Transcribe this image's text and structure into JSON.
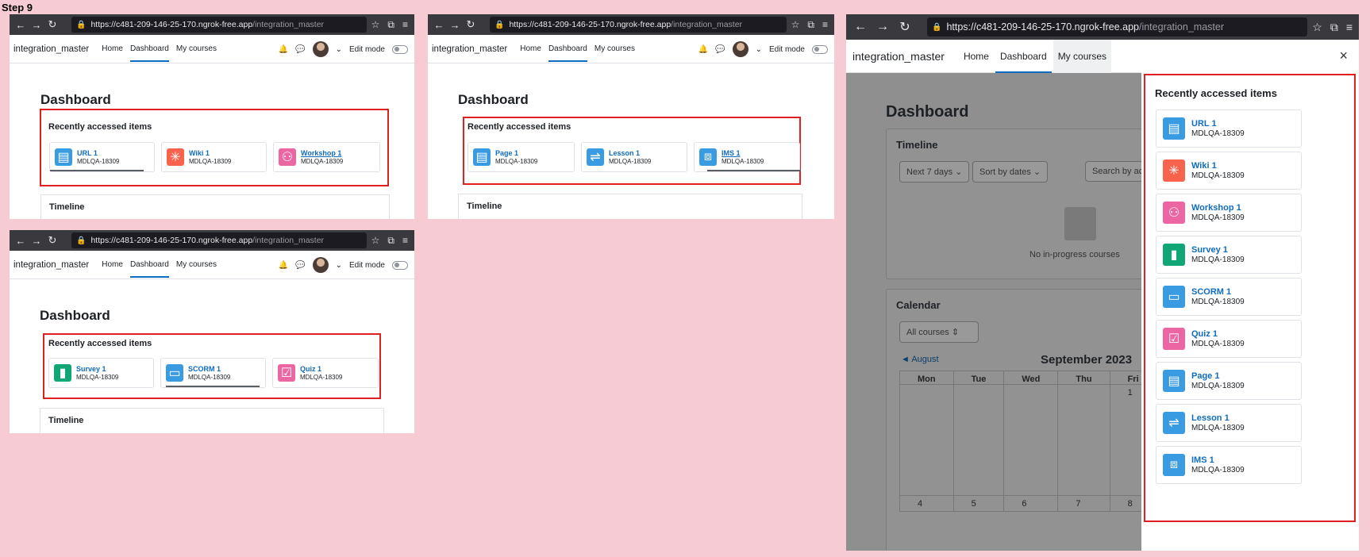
{
  "step_label": "Step 9",
  "browser": {
    "url_main": "https://c481-209-146-25-170.ngrok-free.app",
    "url_tail": "/integration_master"
  },
  "nav": {
    "brand": "integration_master",
    "home": "Home",
    "dashboard": "Dashboard",
    "my_courses": "My courses",
    "edit_mode": "Edit mode"
  },
  "page_title": "Dashboard",
  "recent_title": "Recently accessed items",
  "timeline_title": "Timeline",
  "panels": [
    {
      "items": [
        {
          "name": "URL 1",
          "course": "MDLQA-18309",
          "icon": "url-icon",
          "color": "#399be2"
        },
        {
          "name": "Wiki 1",
          "course": "MDLQA-18309",
          "icon": "wiki-icon",
          "color": "#f7634d"
        },
        {
          "name": "Workshop 1",
          "course": "MDLQA-18309",
          "icon": "workshop-icon",
          "color": "#eb66a2"
        }
      ]
    },
    {
      "items": [
        {
          "name": "Page 1",
          "course": "MDLQA-18309",
          "icon": "page-icon",
          "color": "#399be2"
        },
        {
          "name": "Lesson 1",
          "course": "MDLQA-18309",
          "icon": "lesson-icon",
          "color": "#399be2"
        },
        {
          "name": "IMS 1",
          "course": "MDLQA-18309",
          "icon": "ims-icon",
          "color": "#399be2"
        }
      ]
    },
    {
      "items": [
        {
          "name": "Survey 1",
          "course": "MDLQA-18309",
          "icon": "survey-icon",
          "color": "#11a676"
        },
        {
          "name": "SCORM 1",
          "course": "MDLQA-18309",
          "icon": "scorm-icon",
          "color": "#399be2"
        },
        {
          "name": "Quiz 1",
          "course": "MDLQA-18309",
          "icon": "quiz-icon",
          "color": "#eb66a2"
        }
      ]
    }
  ],
  "drawer": {
    "close": "×",
    "items": [
      {
        "name": "URL 1",
        "course": "MDLQA-18309",
        "icon": "url-icon",
        "color": "#399be2"
      },
      {
        "name": "Wiki 1",
        "course": "MDLQA-18309",
        "icon": "wiki-icon",
        "color": "#f7634d"
      },
      {
        "name": "Workshop 1",
        "course": "MDLQA-18309",
        "icon": "workshop-icon",
        "color": "#eb66a2"
      },
      {
        "name": "Survey 1",
        "course": "MDLQA-18309",
        "icon": "survey-icon",
        "color": "#11a676"
      },
      {
        "name": "SCORM 1",
        "course": "MDLQA-18309",
        "icon": "scorm-icon",
        "color": "#399be2"
      },
      {
        "name": "Quiz 1",
        "course": "MDLQA-18309",
        "icon": "quiz-icon",
        "color": "#eb66a2"
      },
      {
        "name": "Page 1",
        "course": "MDLQA-18309",
        "icon": "page-icon",
        "color": "#399be2"
      },
      {
        "name": "Lesson 1",
        "course": "MDLQA-18309",
        "icon": "lesson-icon",
        "color": "#399be2"
      },
      {
        "name": "IMS 1",
        "course": "MDLQA-18309",
        "icon": "ims-icon",
        "color": "#399be2"
      }
    ]
  },
  "background": {
    "filter_days": "Next 7 days",
    "sort": "Sort by dates",
    "search": "Search by acti",
    "no_courses": "No in-progress courses",
    "calendar_title": "Calendar",
    "all_courses": "All courses",
    "prev_month": "◄ August",
    "month": "September 2023",
    "weekdays": [
      "Mon",
      "Tue",
      "Wed",
      "Thu",
      "Fri"
    ],
    "first_day": "1",
    "bottom_days": [
      "4",
      "5",
      "6",
      "7",
      "8"
    ]
  }
}
